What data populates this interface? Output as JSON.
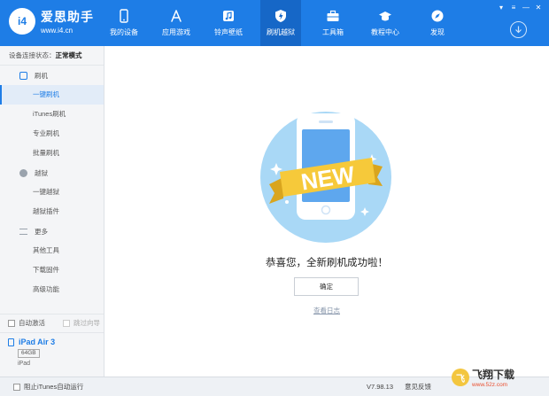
{
  "app": {
    "name": "爱思助手",
    "url": "www.i4.cn"
  },
  "nav": [
    {
      "label": "我的设备",
      "icon": "phone-icon"
    },
    {
      "label": "应用游戏",
      "icon": "apps-icon"
    },
    {
      "label": "铃声壁纸",
      "icon": "music-icon"
    },
    {
      "label": "刷机越狱",
      "icon": "shield-icon",
      "active": true
    },
    {
      "label": "工具箱",
      "icon": "toolbox-icon"
    },
    {
      "label": "教程中心",
      "icon": "graduation-cap-icon"
    },
    {
      "label": "发现",
      "icon": "compass-icon"
    }
  ],
  "sidebar": {
    "status_label": "设备连接状态：",
    "status_value": "正常模式",
    "groups": [
      {
        "label": "刷机",
        "icon": "flash-icon",
        "items": [
          "一键刷机",
          "iTunes刷机",
          "专业刷机",
          "批量刷机"
        ]
      },
      {
        "label": "越狱",
        "icon": "jailbreak-icon",
        "items": [
          "一键越狱",
          "越狱插件"
        ]
      },
      {
        "label": "更多",
        "icon": "menu-icon",
        "items": [
          "其他工具",
          "下载固件",
          "高级功能"
        ]
      }
    ],
    "active_item": "一键刷机",
    "auto_activate": "自动激活",
    "skip_wizard": "跳过向导",
    "device": {
      "name": "iPad Air 3",
      "capacity": "64GB",
      "type": "iPad"
    }
  },
  "main": {
    "badge_text": "NEW",
    "message": "恭喜您，全新刷机成功啦！",
    "confirm": "确定",
    "view_log": "查看日志"
  },
  "footer": {
    "itunes_block": "阻止iTunes自动运行",
    "version": "V7.98.13",
    "feedback": "意见反馈",
    "watermark_title": "飞翔下载",
    "watermark_url": "www.52z.com"
  },
  "colors": {
    "brand": "#1e7de6",
    "ribbon": "#f6c93a",
    "hero_circle": "#a9d8f6"
  }
}
